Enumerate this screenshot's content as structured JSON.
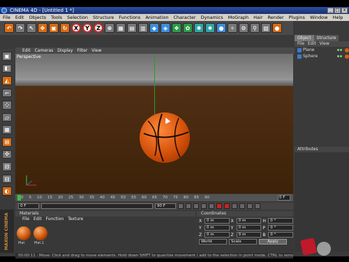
{
  "window": {
    "title": "CINEMA 4D - [Untitled 1 *]",
    "controls": [
      "_",
      "□",
      "x"
    ]
  },
  "menu": [
    "File",
    "Edit",
    "Objects",
    "Tools",
    "Selection",
    "Structure",
    "Functions",
    "Animation",
    "Character",
    "Dynamics",
    "MoGraph",
    "Hair",
    "Render",
    "Plugins",
    "Window",
    "Help"
  ],
  "toolbar": {
    "axis_x": "X",
    "axis_y": "Y",
    "axis_z": "Z"
  },
  "viewport": {
    "menu": [
      "Edit",
      "Cameras",
      "Display",
      "Filter",
      "View"
    ],
    "label": "Perspective"
  },
  "timeline": {
    "ticks": [
      "0",
      "5",
      "10",
      "15",
      "20",
      "25",
      "30",
      "35",
      "40",
      "45",
      "50",
      "55",
      "60",
      "65",
      "70",
      "75",
      "80",
      "85",
      "90"
    ],
    "end_field": "0 F"
  },
  "transport": {
    "start": "0 F",
    "end": "90 F"
  },
  "materials": {
    "header": "Materials",
    "menu": [
      "File",
      "Edit",
      "Function",
      "Texture"
    ],
    "items": [
      "Mat",
      "Mat.1"
    ]
  },
  "brand": "MAXON CINEMA 4D",
  "coordinates": {
    "header": "Coordinates",
    "rows": [
      {
        "axis": "X",
        "pos": "0 m",
        "size": "0 m",
        "rot_label": "H",
        "rot": "0 °"
      },
      {
        "axis": "Y",
        "pos": "0 m",
        "size": "0 m",
        "rot_label": "P",
        "rot": "0 °"
      },
      {
        "axis": "Z",
        "pos": "0 m",
        "size": "0 m",
        "rot_label": "B",
        "rot": "0 °"
      }
    ],
    "mode": "World",
    "scale": "Scale",
    "apply": "Apply"
  },
  "objects_panel": {
    "tabs": [
      "Object",
      "Structure"
    ],
    "menu": [
      "File",
      "Edit",
      "View"
    ],
    "items": [
      "Plane",
      "Sphere"
    ]
  },
  "attributes": {
    "header": "Attributes"
  },
  "status": {
    "text": "00:00:11 :  Move: Click and drag to move elements. Hold down SHIFT to quantize movement / add to the selection in point mode, CTRL to remove."
  }
}
